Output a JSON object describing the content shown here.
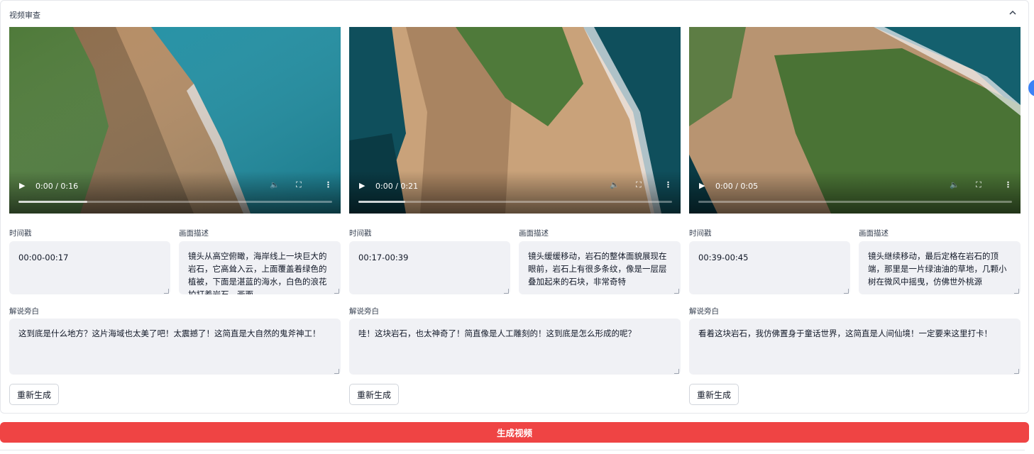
{
  "panel": {
    "title": "视频审查",
    "collapse_icon": "chevron-up-icon"
  },
  "labels": {
    "timestamp": "时间戳",
    "description": "画面描述",
    "narration": "解说旁白"
  },
  "clips": [
    {
      "time_display": "0:00 / 0:16",
      "progress_buffered": 0.22,
      "timestamp": "00:00-00:17",
      "description": "镜头从高空俯瞰，海岸线上一块巨大的岩石，它高耸入云，上面覆盖着绿色的植被，下面是湛蓝的海水，白色的浪花拍打着岩石，画面",
      "narration": "这到底是什么地方？这片海域也太美了吧！太震撼了！这简直是大自然的鬼斧神工！",
      "regen_label": "重新生成"
    },
    {
      "time_display": "0:00 / 0:21",
      "progress_buffered": 0.15,
      "timestamp": "00:17-00:39",
      "description": "镜头缓缓移动，岩石的整体面貌展现在眼前，岩石上有很多条纹，像是一层层叠加起来的石块，非常奇特",
      "narration": "哇！这块岩石，也太神奇了！简直像是人工雕刻的！这到底是怎么形成的呢？",
      "regen_label": "重新生成"
    },
    {
      "time_display": "0:00 / 0:05",
      "progress_buffered": 0.0,
      "timestamp": "00:39-00:45",
      "description": "镜头继续移动，最后定格在岩石的顶端，那里是一片绿油油的草地，几颗小树在微风中摇曳，仿佛世外桃源",
      "narration": "看着这块岩石，我仿佛置身于童话世界，这简直是人间仙境！一定要来这里打卡！",
      "regen_label": "重新生成"
    }
  ],
  "generate_label": "生成视频",
  "colors": {
    "primary": "#ef4444",
    "field_bg": "#f0f1f5",
    "sea": "#1f8fa3",
    "rock": "#c9a27a",
    "grass": "#4f7a3a"
  }
}
